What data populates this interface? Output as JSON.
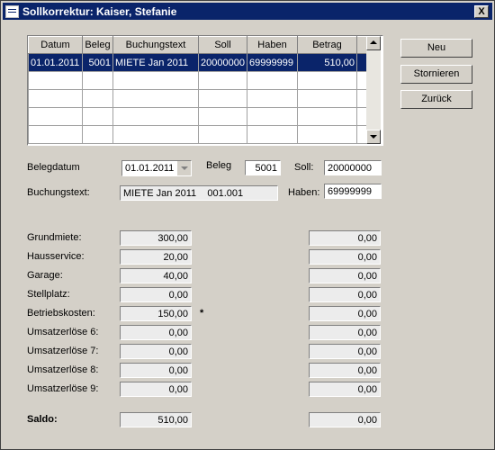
{
  "window": {
    "title": "Sollkorrektur: Kaiser, Stefanie",
    "close_label": "X"
  },
  "grid": {
    "headers": [
      "Datum",
      "Beleg",
      "Buchungstext",
      "Soll",
      "Haben",
      "Betrag"
    ],
    "rows": [
      [
        "01.01.2011",
        "5001",
        "MIETE Jan 2011",
        "20000000",
        "69999999",
        "510,00"
      ],
      [
        "",
        "",
        "",
        "",
        "",
        ""
      ],
      [
        "",
        "",
        "",
        "",
        "",
        ""
      ],
      [
        "",
        "",
        "",
        "",
        "",
        ""
      ],
      [
        "",
        "",
        "",
        "",
        "",
        ""
      ]
    ]
  },
  "buttons": {
    "neu": "Neu",
    "stornieren": "Stornieren",
    "zurueck": "Zurück"
  },
  "form": {
    "belegdatum_label": "Belegdatum",
    "belegdatum_value": "01.01.2011",
    "beleg_label": "Beleg",
    "beleg_value": "5001",
    "soll_label": "Soll:",
    "soll_value": "20000000",
    "buchungstext_label": "Buchungstext:",
    "buchungstext_value": "MIETE Jan 2011    001.001",
    "haben_label": "Haben:",
    "haben_value": "69999999"
  },
  "items": [
    {
      "label": "Grundmiete:",
      "value": "300,00",
      "value2": "0,00",
      "mark": ""
    },
    {
      "label": "Hausservice:",
      "value": "20,00",
      "value2": "0,00",
      "mark": ""
    },
    {
      "label": "Garage:",
      "value": "40,00",
      "value2": "0,00",
      "mark": ""
    },
    {
      "label": "Stellplatz:",
      "value": "0,00",
      "value2": "0,00",
      "mark": ""
    },
    {
      "label": "Betriebskosten:",
      "value": "150,00",
      "value2": "0,00",
      "mark": "*"
    },
    {
      "label": "Umsatzerlöse 6:",
      "value": "0,00",
      "value2": "0,00",
      "mark": ""
    },
    {
      "label": "Umsatzerlöse 7:",
      "value": "0,00",
      "value2": "0,00",
      "mark": ""
    },
    {
      "label": "Umsatzerlöse 8:",
      "value": "0,00",
      "value2": "0,00",
      "mark": ""
    },
    {
      "label": "Umsatzerlöse 9:",
      "value": "0,00",
      "value2": "0,00",
      "mark": ""
    }
  ],
  "saldo": {
    "label": "Saldo:",
    "value": "510,00",
    "value2": "0,00"
  }
}
